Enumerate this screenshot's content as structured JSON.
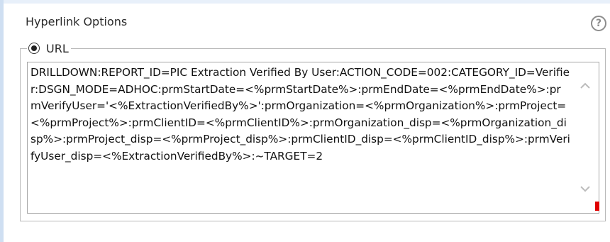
{
  "panel": {
    "title": "Hyperlink Options",
    "help_icon": "help-icon",
    "help_glyph": "?"
  },
  "link_type": {
    "option_label": "URL",
    "selected": true,
    "icon": "radio-selected-icon"
  },
  "url_field": {
    "value": "DRILLDOWN:REPORT_ID=PIC Extraction Verified By User:ACTION_CODE=002:CATEGORY_ID=Verifier:DSGN_MODE=ADHOC:prmStartDate=<%prmStartDate%>:prmEndDate=<%prmEndDate%>:prmVerifyUser='<%ExtractionVerifiedBy%>':prmOrganization=<%prmOrganization%>:prmProject=<%prmProject%>:prmClientID=<%prmClientID%>:prmOrganization_disp=<%prmOrganization_disp%>:prmProject_disp=<%prmProject_disp%>:prmClientID_disp=<%prmClientID_disp%>:prmVerifyUser_disp=<%ExtractionVerifiedBy%>:~TARGET=2",
    "scroll_up_icon": "chevron-up-icon",
    "scroll_down_icon": "chevron-down-icon"
  },
  "colors": {
    "left_rail": "#cfdff2",
    "border": "#b8b8b8",
    "text": "#111111",
    "marker": "#e00000"
  }
}
